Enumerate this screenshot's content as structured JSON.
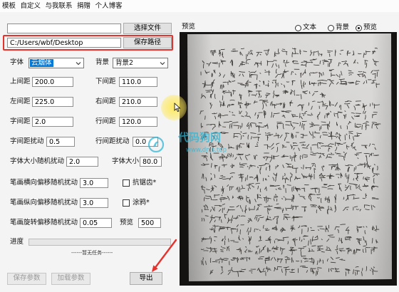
{
  "menu": {
    "items": [
      "模板",
      "自定义",
      "与我联系",
      "捐赠",
      "个人博客"
    ]
  },
  "file": {
    "input_value": "",
    "select_button": "选择文件"
  },
  "save_path": {
    "input_value": "C:/Users/wbf/Desktop",
    "button": "保存路径"
  },
  "font": {
    "label": "字体",
    "selected": "云烟体"
  },
  "background": {
    "label": "背景",
    "selected": "背景2"
  },
  "params": {
    "top_margin": {
      "label": "上间距",
      "value": "200.0"
    },
    "bottom_margin": {
      "label": "下间距",
      "value": "110.0"
    },
    "left_margin": {
      "label": "左间距",
      "value": "225.0"
    },
    "right_margin": {
      "label": "右间距",
      "value": "210.0"
    },
    "char_spacing": {
      "label": "字间距",
      "value": "2.0"
    },
    "line_spacing": {
      "label": "行间距",
      "value": "120.0"
    },
    "char_spacing_jitter": {
      "label": "字间距扰动",
      "value": "0.5"
    },
    "line_spacing_jitter": {
      "label": "行间距扰动",
      "value": "0.0"
    },
    "font_size_jitter": {
      "label": "字体大小随机扰动",
      "value": "2.0"
    },
    "font_size": {
      "label": "字体大小",
      "value": "80.0"
    },
    "stroke_x_jitter": {
      "label": "笔画横向偏移随机扰动",
      "value": "3.0"
    },
    "stroke_y_jitter": {
      "label": "笔画纵向偏移随机扰动",
      "value": "3.0"
    },
    "stroke_rotation_jitter": {
      "label": "笔画旋转偏移随机扰动",
      "value": "0.05"
    },
    "preview_size": {
      "label": "预览",
      "value": "500"
    }
  },
  "options": {
    "antialias": {
      "label": "抗锯齿*",
      "checked": false
    },
    "doodle": {
      "label": "涂鸦*",
      "checked": false
    }
  },
  "progress": {
    "label": "进度",
    "percent": 0,
    "status": "------暂无任务------"
  },
  "actions": {
    "save_params": "保存参数",
    "load_params": "加载参数",
    "export": "导出"
  },
  "preview": {
    "label": "预览",
    "modes": [
      {
        "label": "文本",
        "selected": false
      },
      {
        "label": "背景",
        "selected": false
      },
      {
        "label": "预览",
        "selected": true
      }
    ]
  },
  "watermark": {
    "name": "代码狗网",
    "url": "www.dnjs.top"
  },
  "colors": {
    "highlight_box": "#e5322d",
    "selection": "#0078d7",
    "watermark": "#2bb5d6",
    "arrow": "#e5322d"
  }
}
